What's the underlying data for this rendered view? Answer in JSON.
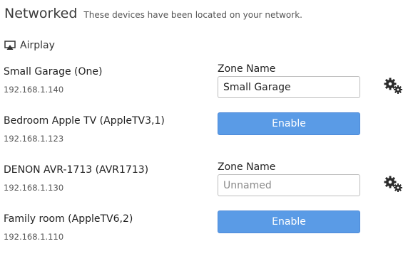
{
  "header": {
    "title": "Networked",
    "subtitle": "These devices have been located on your network."
  },
  "section": {
    "label": "Airplay",
    "icon": "airplay-icon"
  },
  "devices": [
    {
      "name": "Small Garage (One)",
      "ip": "192.168.1.140",
      "zone_label": "Zone Name",
      "zone_value": "Small Garage",
      "zone_placeholder": "",
      "settings_icon": "gears-icon"
    },
    {
      "name": "Bedroom Apple TV (AppleTV3,1)",
      "ip": "192.168.1.123",
      "enable_label": "Enable"
    },
    {
      "name": "DENON AVR-1713 (AVR1713)",
      "ip": "192.168.1.130",
      "zone_label": "Zone Name",
      "zone_value": "",
      "zone_placeholder": "Unnamed",
      "settings_icon": "gears-icon"
    },
    {
      "name": "Family room (AppleTV6,2)",
      "ip": "192.168.1.110",
      "enable_label": "Enable"
    }
  ],
  "colors": {
    "button": "#5a9be6",
    "text": "#222222",
    "muted": "#555555"
  }
}
